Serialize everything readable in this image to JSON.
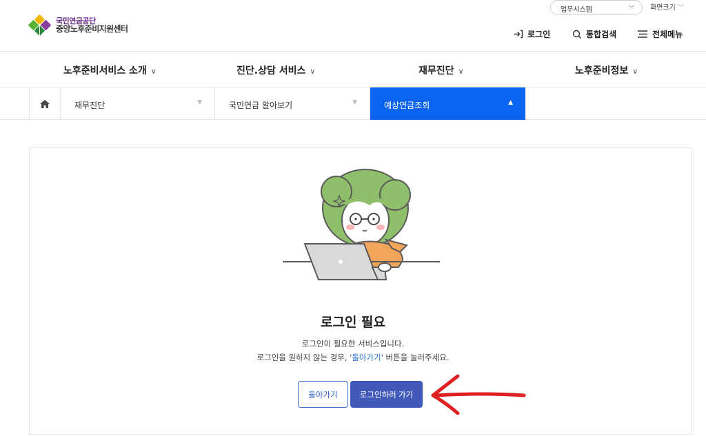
{
  "header": {
    "logo_org": "국민연금공단",
    "logo_center": "중앙노후준비지원센터",
    "system_select": "업무시스템",
    "zoom_label": "화면크기",
    "login": "로그인",
    "search": "통합검색",
    "menu": "전체메뉴"
  },
  "gnb": {
    "items": [
      {
        "label": "노후준비서비스 소개"
      },
      {
        "label": "진단.상담 서비스"
      },
      {
        "label": "재무진단"
      },
      {
        "label": "노후준비정보"
      }
    ]
  },
  "breadcrumb": {
    "items": [
      {
        "label": "재무진단"
      },
      {
        "label": "국민연금 알아보기"
      },
      {
        "label": "예상연금조회"
      }
    ]
  },
  "content": {
    "title": "로그인 필요",
    "desc_line1": "로그인이 필요한 서비스입니다.",
    "desc_line2_pre": "로그인을 원하지 않는 경우, '",
    "desc_line2_link": "돌아가기",
    "desc_line2_post": "' 버튼을 눌러주세요.",
    "back_button": "돌아가기",
    "login_button": "로그인하러 가기"
  },
  "colors": {
    "active_tab": "#0a64f0",
    "primary_button": "#4159b8",
    "annotation_arrow": "#e02020"
  },
  "icons": {
    "home": "home-icon",
    "login": "login-arrow-icon",
    "search": "search-icon",
    "menu": "hamburger-menu-icon"
  }
}
